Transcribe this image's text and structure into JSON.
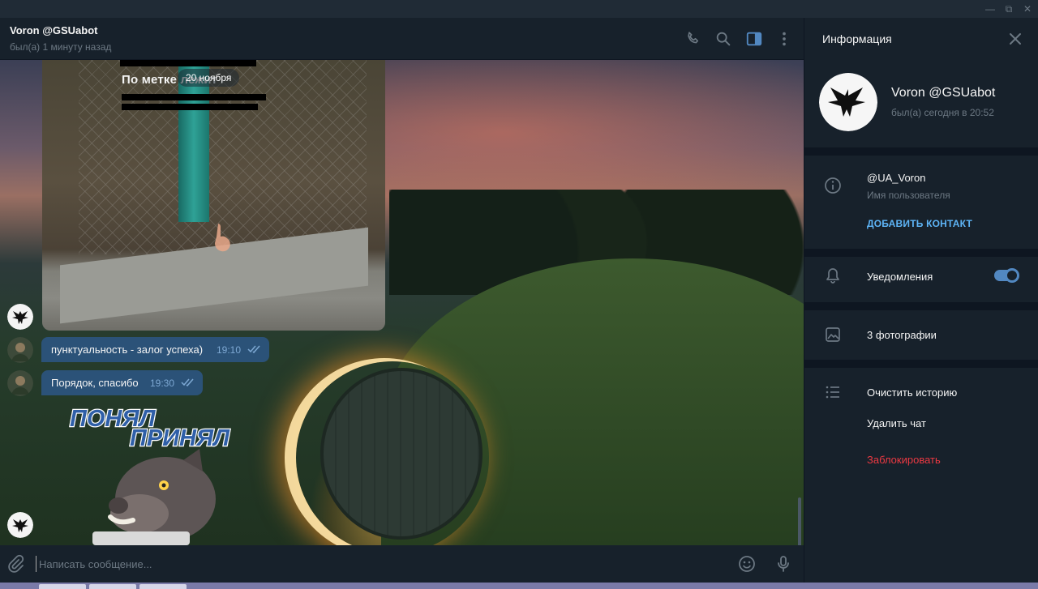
{
  "chat": {
    "title": "Voron @GSUabot",
    "status": "был(а) 1 минуту назад"
  },
  "messages": {
    "date_label": "20 ноября",
    "photo_caption": "По метке лежит",
    "items": [
      {
        "text": "пунктуальность - залог успеха)",
        "time": "19:10"
      },
      {
        "text": "Порядок, спасибо",
        "time": "19:30"
      }
    ],
    "sticker_text": [
      "ПОНЯЛ",
      "ПРИНЯЛ"
    ]
  },
  "compose": {
    "placeholder": "Написать сообщение..."
  },
  "info": {
    "title": "Информация",
    "name": "Voron @GSUabot",
    "status": "был(а) сегодня в 20:52",
    "username": "@UA_Voron",
    "username_label": "Имя пользователя",
    "add_contact": "ДОБАВИТЬ КОНТАКТ",
    "notifications": "Уведомления",
    "notifications_on": true,
    "photos": "3 фотографии",
    "clear_history": "Очистить историю",
    "delete_chat": "Удалить чат",
    "block": "Заблокировать"
  },
  "icons": {
    "header": [
      "phone-icon",
      "search-icon",
      "sidebar-toggle-icon",
      "more-icon"
    ],
    "compose": [
      "attach-icon",
      "emoji-icon",
      "microphone-icon"
    ],
    "info": [
      "info-icon",
      "bell-icon",
      "photo-icon",
      "list-icon"
    ]
  },
  "colors": {
    "bg": "#17212b",
    "bubble": "#2b5278",
    "accent": "#5288c1",
    "link": "#5eb5f7",
    "danger": "#ec3942"
  }
}
